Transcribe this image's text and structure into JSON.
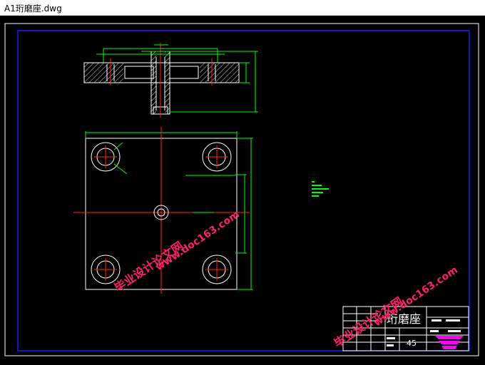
{
  "window": {
    "title": "A1珩磨座.dwg"
  },
  "drawing": {
    "colors": {
      "background": "#000000",
      "frame": "#1a1aff",
      "outline": "#ffffff",
      "dimension": "#00ff00",
      "centerline": "#ff2020",
      "watermark": "#ff1f6b",
      "logo": "#ff00ff"
    },
    "title_block": {
      "part_name": "珩磨座",
      "material": "45"
    },
    "watermark": {
      "site_name": "毕业设计论文网",
      "url": "www.doc163.com"
    }
  }
}
